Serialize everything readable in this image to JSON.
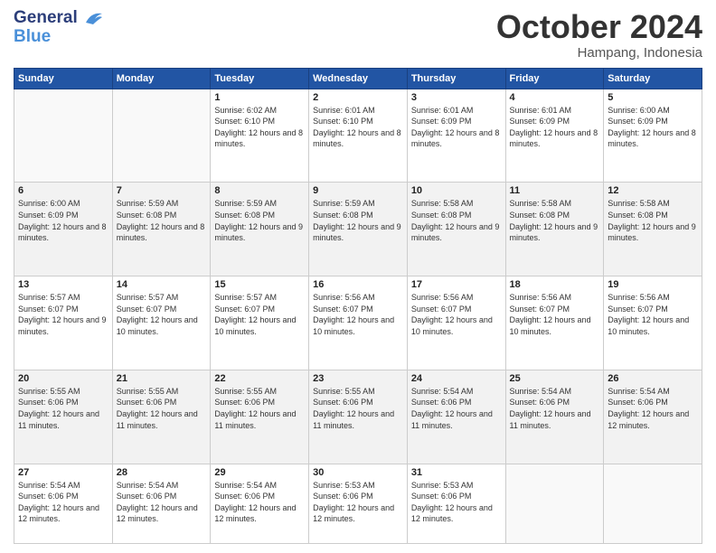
{
  "header": {
    "logo_line1": "General",
    "logo_line2": "Blue",
    "month": "October 2024",
    "location": "Hampang, Indonesia"
  },
  "days_of_week": [
    "Sunday",
    "Monday",
    "Tuesday",
    "Wednesday",
    "Thursday",
    "Friday",
    "Saturday"
  ],
  "weeks": [
    [
      {
        "num": "",
        "info": ""
      },
      {
        "num": "",
        "info": ""
      },
      {
        "num": "1",
        "info": "Sunrise: 6:02 AM\nSunset: 6:10 PM\nDaylight: 12 hours and 8 minutes."
      },
      {
        "num": "2",
        "info": "Sunrise: 6:01 AM\nSunset: 6:10 PM\nDaylight: 12 hours and 8 minutes."
      },
      {
        "num": "3",
        "info": "Sunrise: 6:01 AM\nSunset: 6:09 PM\nDaylight: 12 hours and 8 minutes."
      },
      {
        "num": "4",
        "info": "Sunrise: 6:01 AM\nSunset: 6:09 PM\nDaylight: 12 hours and 8 minutes."
      },
      {
        "num": "5",
        "info": "Sunrise: 6:00 AM\nSunset: 6:09 PM\nDaylight: 12 hours and 8 minutes."
      }
    ],
    [
      {
        "num": "6",
        "info": "Sunrise: 6:00 AM\nSunset: 6:09 PM\nDaylight: 12 hours and 8 minutes."
      },
      {
        "num": "7",
        "info": "Sunrise: 5:59 AM\nSunset: 6:08 PM\nDaylight: 12 hours and 8 minutes."
      },
      {
        "num": "8",
        "info": "Sunrise: 5:59 AM\nSunset: 6:08 PM\nDaylight: 12 hours and 9 minutes."
      },
      {
        "num": "9",
        "info": "Sunrise: 5:59 AM\nSunset: 6:08 PM\nDaylight: 12 hours and 9 minutes."
      },
      {
        "num": "10",
        "info": "Sunrise: 5:58 AM\nSunset: 6:08 PM\nDaylight: 12 hours and 9 minutes."
      },
      {
        "num": "11",
        "info": "Sunrise: 5:58 AM\nSunset: 6:08 PM\nDaylight: 12 hours and 9 minutes."
      },
      {
        "num": "12",
        "info": "Sunrise: 5:58 AM\nSunset: 6:08 PM\nDaylight: 12 hours and 9 minutes."
      }
    ],
    [
      {
        "num": "13",
        "info": "Sunrise: 5:57 AM\nSunset: 6:07 PM\nDaylight: 12 hours and 9 minutes."
      },
      {
        "num": "14",
        "info": "Sunrise: 5:57 AM\nSunset: 6:07 PM\nDaylight: 12 hours and 10 minutes."
      },
      {
        "num": "15",
        "info": "Sunrise: 5:57 AM\nSunset: 6:07 PM\nDaylight: 12 hours and 10 minutes."
      },
      {
        "num": "16",
        "info": "Sunrise: 5:56 AM\nSunset: 6:07 PM\nDaylight: 12 hours and 10 minutes."
      },
      {
        "num": "17",
        "info": "Sunrise: 5:56 AM\nSunset: 6:07 PM\nDaylight: 12 hours and 10 minutes."
      },
      {
        "num": "18",
        "info": "Sunrise: 5:56 AM\nSunset: 6:07 PM\nDaylight: 12 hours and 10 minutes."
      },
      {
        "num": "19",
        "info": "Sunrise: 5:56 AM\nSunset: 6:07 PM\nDaylight: 12 hours and 10 minutes."
      }
    ],
    [
      {
        "num": "20",
        "info": "Sunrise: 5:55 AM\nSunset: 6:06 PM\nDaylight: 12 hours and 11 minutes."
      },
      {
        "num": "21",
        "info": "Sunrise: 5:55 AM\nSunset: 6:06 PM\nDaylight: 12 hours and 11 minutes."
      },
      {
        "num": "22",
        "info": "Sunrise: 5:55 AM\nSunset: 6:06 PM\nDaylight: 12 hours and 11 minutes."
      },
      {
        "num": "23",
        "info": "Sunrise: 5:55 AM\nSunset: 6:06 PM\nDaylight: 12 hours and 11 minutes."
      },
      {
        "num": "24",
        "info": "Sunrise: 5:54 AM\nSunset: 6:06 PM\nDaylight: 12 hours and 11 minutes."
      },
      {
        "num": "25",
        "info": "Sunrise: 5:54 AM\nSunset: 6:06 PM\nDaylight: 12 hours and 11 minutes."
      },
      {
        "num": "26",
        "info": "Sunrise: 5:54 AM\nSunset: 6:06 PM\nDaylight: 12 hours and 12 minutes."
      }
    ],
    [
      {
        "num": "27",
        "info": "Sunrise: 5:54 AM\nSunset: 6:06 PM\nDaylight: 12 hours and 12 minutes."
      },
      {
        "num": "28",
        "info": "Sunrise: 5:54 AM\nSunset: 6:06 PM\nDaylight: 12 hours and 12 minutes."
      },
      {
        "num": "29",
        "info": "Sunrise: 5:54 AM\nSunset: 6:06 PM\nDaylight: 12 hours and 12 minutes."
      },
      {
        "num": "30",
        "info": "Sunrise: 5:53 AM\nSunset: 6:06 PM\nDaylight: 12 hours and 12 minutes."
      },
      {
        "num": "31",
        "info": "Sunrise: 5:53 AM\nSunset: 6:06 PM\nDaylight: 12 hours and 12 minutes."
      },
      {
        "num": "",
        "info": ""
      },
      {
        "num": "",
        "info": ""
      }
    ]
  ]
}
